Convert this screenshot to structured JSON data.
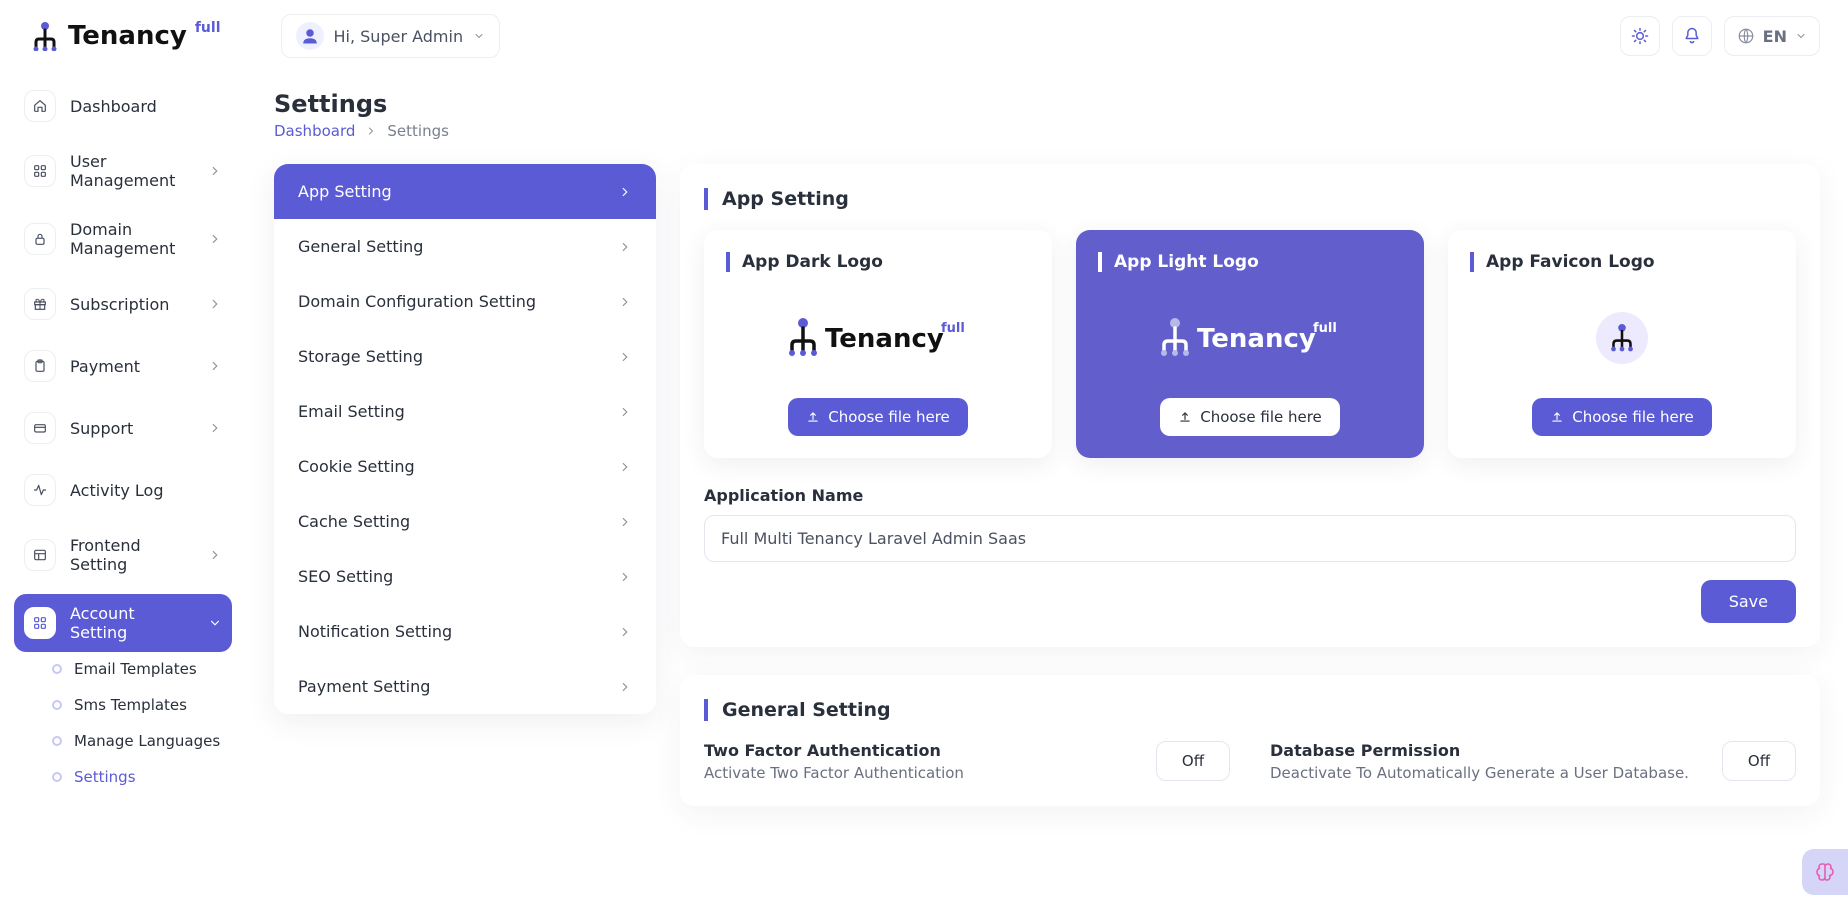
{
  "brand": {
    "name": "Tenancy",
    "sup": "full"
  },
  "user": {
    "greeting": "Hi, Super Admin"
  },
  "lang": {
    "code": "EN"
  },
  "page": {
    "title": "Settings"
  },
  "crumbs": {
    "root": "Dashboard",
    "current": "Settings"
  },
  "sidebar": {
    "items": [
      {
        "label": "Dashboard",
        "expandable": false
      },
      {
        "label": "User Management",
        "expandable": true
      },
      {
        "label": "Domain Management",
        "expandable": true
      },
      {
        "label": "Subscription",
        "expandable": true
      },
      {
        "label": "Payment",
        "expandable": true
      },
      {
        "label": "Support",
        "expandable": true
      },
      {
        "label": "Activity Log",
        "expandable": false
      },
      {
        "label": "Frontend Setting",
        "expandable": true
      },
      {
        "label": "Account Setting",
        "expandable": true
      }
    ],
    "sub": [
      {
        "label": "Email Templates"
      },
      {
        "label": "Sms Templates"
      },
      {
        "label": "Manage Languages"
      },
      {
        "label": "Settings"
      }
    ]
  },
  "settingsNav": [
    {
      "label": "App Setting",
      "active": true
    },
    {
      "label": "General Setting"
    },
    {
      "label": "Domain Configuration Setting"
    },
    {
      "label": "Storage Setting"
    },
    {
      "label": "Email Setting"
    },
    {
      "label": "Cookie Setting"
    },
    {
      "label": "Cache Setting"
    },
    {
      "label": "SEO Setting"
    },
    {
      "label": "Notification Setting"
    },
    {
      "label": "Payment Setting"
    }
  ],
  "appSetting": {
    "section": "App Setting",
    "cards": {
      "dark": "App Dark Logo",
      "light": "App Light Logo",
      "favicon": "App Favicon Logo"
    },
    "chooseFile": "Choose file here",
    "appNameLabel": "Application Name",
    "appNameValue": "Full Multi Tenancy Laravel Admin Saas",
    "save": "Save"
  },
  "generalSetting": {
    "section": "General Setting",
    "twofa": {
      "title": "Two Factor Authentication",
      "desc": "Activate Two Factor Authentication",
      "state": "Off"
    },
    "dbperm": {
      "title": "Database Permission",
      "desc": "Deactivate To Automatically Generate a User Database.",
      "state": "Off"
    }
  }
}
